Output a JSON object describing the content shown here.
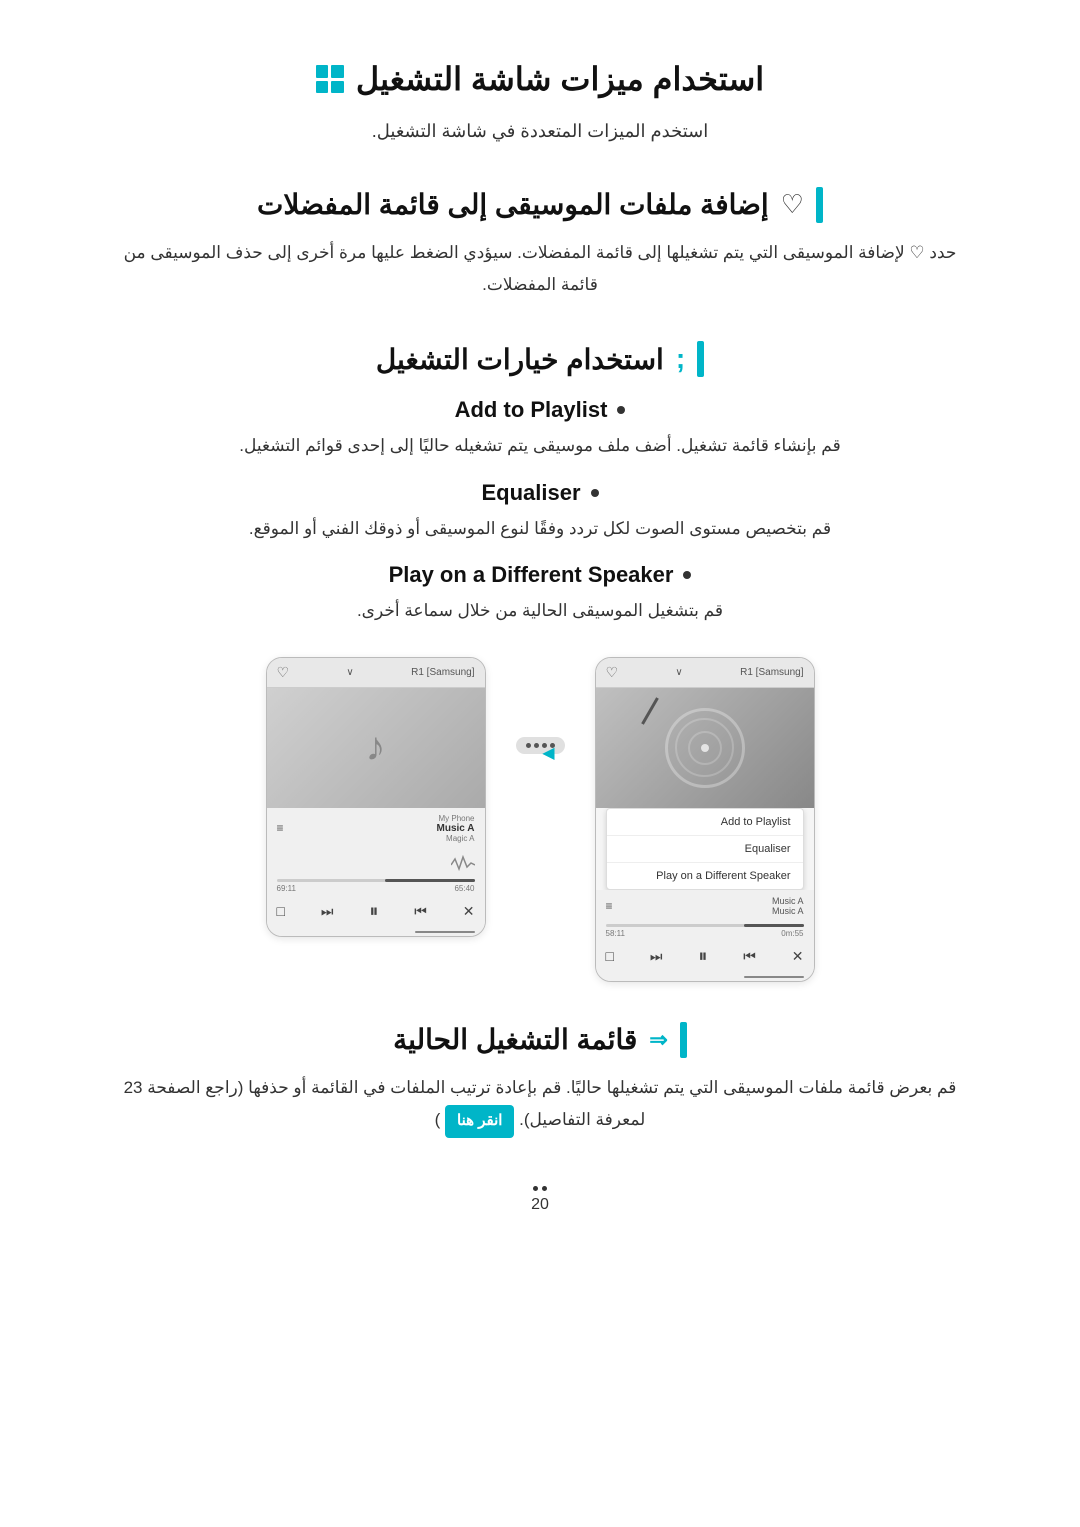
{
  "page": {
    "number": "20"
  },
  "section1": {
    "title": "استخدام ميزات شاشة التشغيل",
    "intro": "استخدم الميزات المتعددة في شاشة التشغيل."
  },
  "section2": {
    "title": "إضافة ملفات الموسيقى إلى قائمة المفضلات",
    "body": "حدد ♡ لإضافة الموسيقى التي يتم تشغيلها إلى قائمة المفضلات. سيؤدي الضغط عليها مرة أخرى إلى حذف الموسيقى من قائمة المفضلات."
  },
  "section3": {
    "title": "استخدام خيارات التشغيل",
    "items": [
      {
        "title": "Add to Playlist",
        "body": "قم بإنشاء قائمة تشغيل. أضف ملف موسيقى يتم تشغيله حاليًا إلى إحدى قوائم التشغيل."
      },
      {
        "title": "Equaliser",
        "body": "قم بتخصيص مستوى الصوت لكل تردد وفقًا لنوع الموسيقى أو ذوقك الفني أو الموقع."
      },
      {
        "title": "Play on a Different Speaker",
        "body": "قم بتشغيل الموسيقى الحالية من خلال سماعة أخرى."
      }
    ]
  },
  "phones": {
    "left": {
      "brand": "[Samsung] R1",
      "track_name": "Music A",
      "track_sub": "Music A",
      "time_left": "0m:55",
      "time_right": "58:11",
      "menu_items": [
        "Add to Playlist",
        "Equaliser",
        "Play on a Different Speaker"
      ]
    },
    "right": {
      "brand": "[Samsung] R1",
      "track_source": "My Phone",
      "track_name": "Music A",
      "track_sub": "Magic A",
      "time_left": "65:40",
      "time_right": "69:11"
    }
  },
  "section4": {
    "title": "قائمة التشغيل الحالية",
    "body": "قم بعرض قائمة ملفات الموسيقى التي يتم تشغيلها حاليًا. قم بإعادة ترتيب الملفات في القائمة أو حذفها (راجع الصفحة 23 لمعرفة التفاصيل).",
    "link_label": "انقر هنا"
  },
  "footer": {
    "page_number": "20"
  }
}
